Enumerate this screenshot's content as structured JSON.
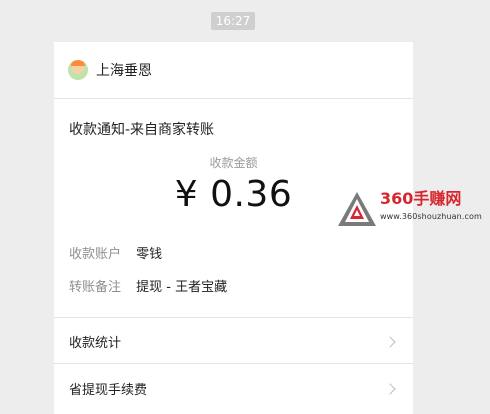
{
  "time_badge": "16:27",
  "merchant": {
    "name": "上海垂恩"
  },
  "notice": {
    "title": "收款通知-来自商家转账",
    "amount_label": "收款金额",
    "amount": "¥ 0.36",
    "details": [
      {
        "key": "收款账户",
        "value": "零钱"
      },
      {
        "key": "转账备注",
        "value": "提现 - 王者宝藏"
      }
    ]
  },
  "links": [
    {
      "label": "收款统计"
    },
    {
      "label": "省提现手续费"
    }
  ],
  "watermark": {
    "brand": "360手赚网",
    "url": "www.360shouzhuan.com"
  },
  "icons": {
    "chevron": "chevron-right-icon",
    "avatar": "avatar-icon",
    "logo": "triangle-logo-icon"
  },
  "colors": {
    "background": "#ededed",
    "card": "#ffffff",
    "watermark_red": "#d7262d"
  }
}
